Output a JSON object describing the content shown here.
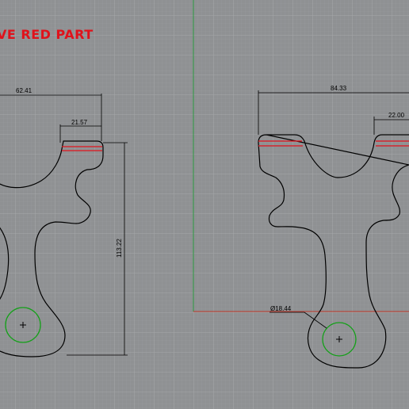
{
  "viewport": {
    "background": "#8f9193",
    "grid_minor_color": "#9c9ea0",
    "grid_major_color": "#a9abad",
    "axis_x_color": "#c0392b",
    "axis_y_color": "#2e9a40"
  },
  "colors": {
    "outline": "#000000",
    "highlight": "#e0121b",
    "hole": "#14a019",
    "dimension": "#000000"
  },
  "annotation": {
    "text": "VE RED PART"
  },
  "left_part": {
    "dims": {
      "overall_width": "62.41",
      "slot_width": "21.57",
      "height": "113.22"
    }
  },
  "right_part": {
    "dims": {
      "overall_width": "84.33",
      "slot_width": "22.00",
      "hole_diameter": "Ø18.44"
    }
  }
}
